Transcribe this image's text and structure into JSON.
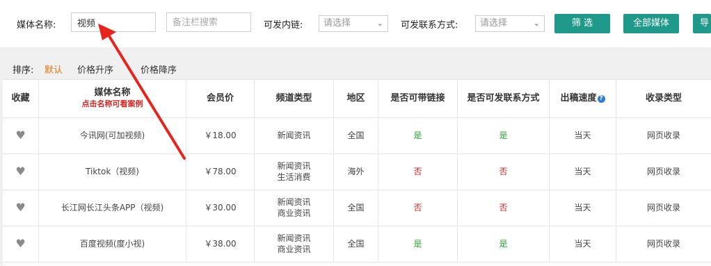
{
  "filters": {
    "media_name_label": "媒体名称:",
    "media_name_value": "视频",
    "remark_placeholder": "备注栏搜索",
    "link_label": "可发内链:",
    "link_select": "请选择",
    "contact_label": "可发联系方式:",
    "contact_select": "请选择",
    "filter_button": "筛 选",
    "all_media_button": "全部媒体",
    "export_button": "导"
  },
  "sort": {
    "label": "排序:",
    "options": [
      "默认",
      "价格升序",
      "价格降序"
    ]
  },
  "table": {
    "headers": {
      "fav": "收藏",
      "name": "媒体名称",
      "name_hint": "点击名称可看案例",
      "price": "会员价",
      "channel": "频道类型",
      "region": "地区",
      "link": "是否可带链接",
      "contact": "是否可发联系方式",
      "speed": "出稿速度",
      "index": "收录类型"
    },
    "rows": [
      {
        "name": "今讯网(可加视频)",
        "price": "￥18.00",
        "channel1": "新闻资讯",
        "channel2": "",
        "region": "全国",
        "link": "是",
        "contact": "是",
        "speed": "当天",
        "index": "网页收录"
      },
      {
        "name": "Tiktok（视频)",
        "price": "￥78.00",
        "channel1": "新闻资讯",
        "channel2": "生活消费",
        "region": "海外",
        "link": "否",
        "contact": "否",
        "speed": "当天",
        "index": "网页收录"
      },
      {
        "name": "长江网长江头条APP（视频)",
        "price": "￥30.00",
        "channel1": "新闻资讯",
        "channel2": "商业资讯",
        "region": "全国",
        "link": "否",
        "contact": "否",
        "speed": "当天",
        "index": "网页收录"
      },
      {
        "name": "百度视频(度小视)",
        "price": "￥38.00",
        "channel1": "新闻资讯",
        "channel2": "商业资讯",
        "region": "全国",
        "link": "是",
        "contact": "是",
        "speed": "当天",
        "index": "网页收录"
      }
    ]
  },
  "colors": {
    "accent": "#1f9a8a",
    "sort_active": "#e8730c",
    "yes": "#2aa333",
    "no": "#d9231f",
    "annotation_arrow": "#e8231c"
  }
}
